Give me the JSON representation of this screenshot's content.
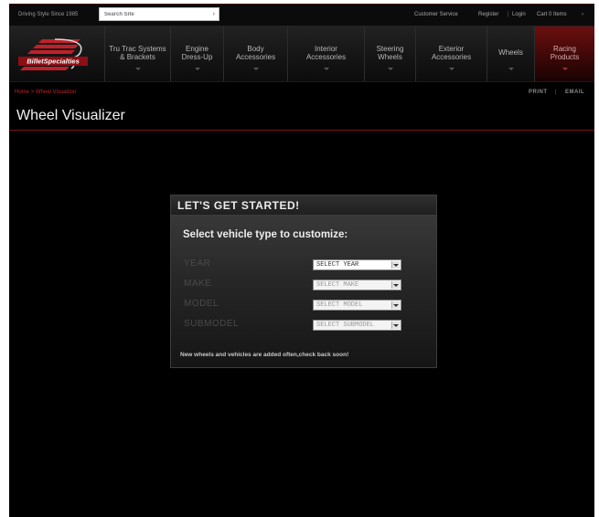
{
  "topbar": {
    "tagline": "Driving Style Since 1985",
    "search_placeholder": "Search Site",
    "search_go": "›",
    "customer_service": "Customer Service",
    "register": "Register",
    "separator": "|",
    "login": "Login",
    "cart": "Cart 0 Items",
    "cart_arrow": "›"
  },
  "brand": {
    "name": "BilletSpecialties",
    "accent_color": "#c0202a"
  },
  "nav": {
    "items": [
      {
        "label_1": "Tru Trac Systems",
        "label_2": "& Brackets"
      },
      {
        "label_1": "Engine",
        "label_2": "Dress-Up"
      },
      {
        "label_1": "Body",
        "label_2": "Accessories"
      },
      {
        "label_1": "Interior",
        "label_2": "Accessories"
      },
      {
        "label_1": "Steering",
        "label_2": "Wheels"
      },
      {
        "label_1": "Exterior",
        "label_2": "Accessories"
      },
      {
        "label_1": "Wheels",
        "label_2": ""
      },
      {
        "label_1": "Racing",
        "label_2": "Products"
      }
    ]
  },
  "breadcrumb": {
    "home": "Home",
    "separator": ">",
    "current": "Wheel Visualizer"
  },
  "page_actions": {
    "print": "PRINT",
    "separator": "|",
    "email": "EMAIL"
  },
  "page_title": "Wheel Visualizer",
  "visualizer": {
    "heading": "LET'S GET STARTED!",
    "subheading": "Select vehicle type to customize:",
    "fields": [
      {
        "label": "YEAR",
        "selected": "SELECT YEAR"
      },
      {
        "label": "MAKE",
        "selected": "SELECT MAKE"
      },
      {
        "label": "MODEL",
        "selected": "SELECT MODEL"
      },
      {
        "label": "SUBMODEL",
        "selected": "SELECT SUBMODEL"
      }
    ],
    "note": "New wheels and vehicles are added often,check back soon!"
  }
}
